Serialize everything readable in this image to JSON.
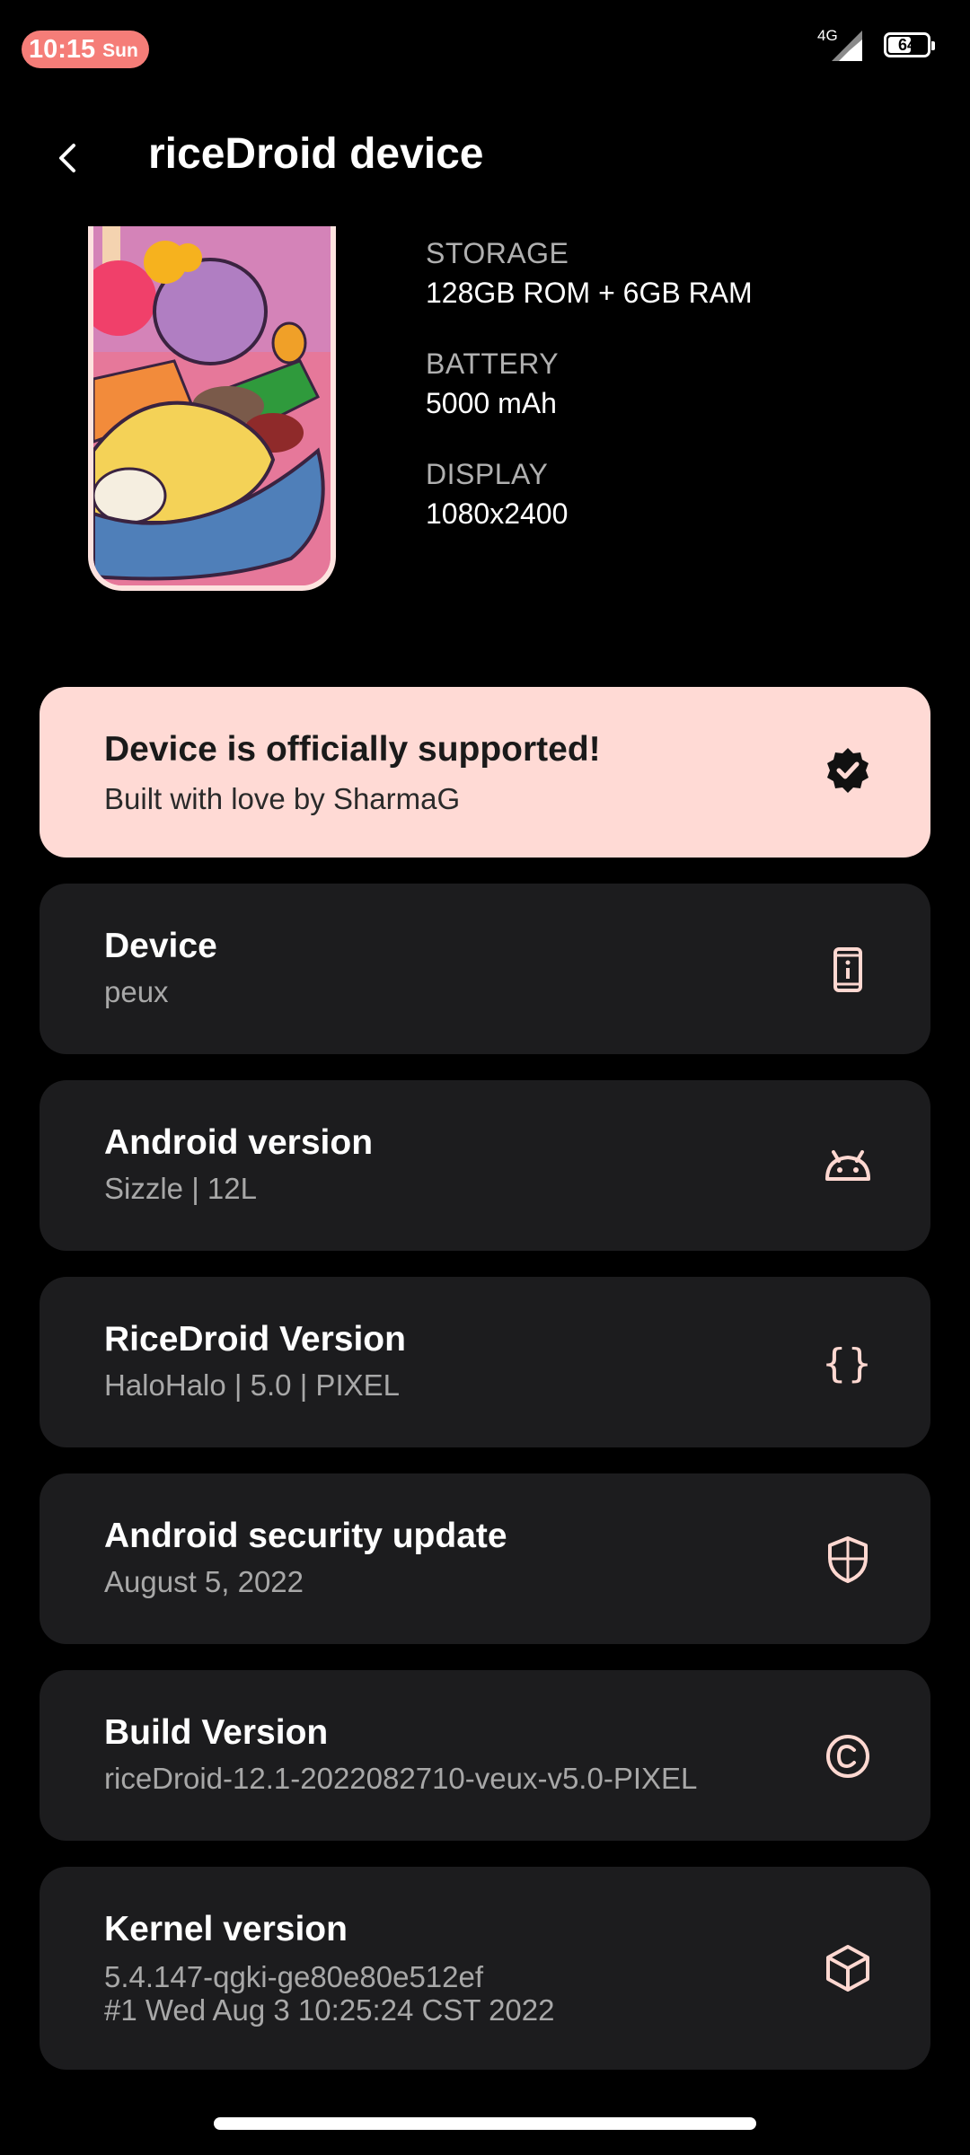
{
  "status_bar": {
    "time": "10:15",
    "day": "Sun",
    "network": "4G",
    "battery_level": "64",
    "battery_fraction": 0.64,
    "accent": "#f57d78"
  },
  "header": {
    "back_icon": "arrow-back-icon",
    "title": "riceDroid device"
  },
  "specs": [
    {
      "label": "STORAGE",
      "value": "128GB ROM + 6GB RAM"
    },
    {
      "label": "BATTERY",
      "value": "5000 mAh"
    },
    {
      "label": "DISPLAY",
      "value": "1080x2400"
    }
  ],
  "support_card": {
    "title": "Device is officially supported!",
    "subtitle": "Built with love by SharmaG",
    "icon": "verified-badge-icon",
    "background": "#ffdad5"
  },
  "cards": [
    {
      "title": "Device",
      "subtitle": "peux",
      "icon": "phone-info-icon"
    },
    {
      "title": "Android version",
      "subtitle": "Sizzle | 12L",
      "icon": "android-icon"
    },
    {
      "title": "RiceDroid Version",
      "subtitle": "HaloHalo | 5.0 | PIXEL",
      "icon": "code-braces-icon",
      "icon_glyph": "{}"
    },
    {
      "title": "Android security update",
      "subtitle": "August 5, 2022",
      "icon": "shield-icon"
    },
    {
      "title": "Build Version",
      "subtitle": "riceDroid-12.1-2022082710-veux-v5.0-PIXEL",
      "icon": "copyright-icon"
    },
    {
      "title": "Kernel version",
      "subtitle_line1": "5.4.147-qgki-ge80e80e512ef",
      "subtitle_line2": "#1 Wed Aug 3 10:25:24 CST 2022",
      "icon": "cube-icon"
    }
  ],
  "colors": {
    "card_bg": "#1c1c1e",
    "icon_tint": "#ffd8d1"
  }
}
